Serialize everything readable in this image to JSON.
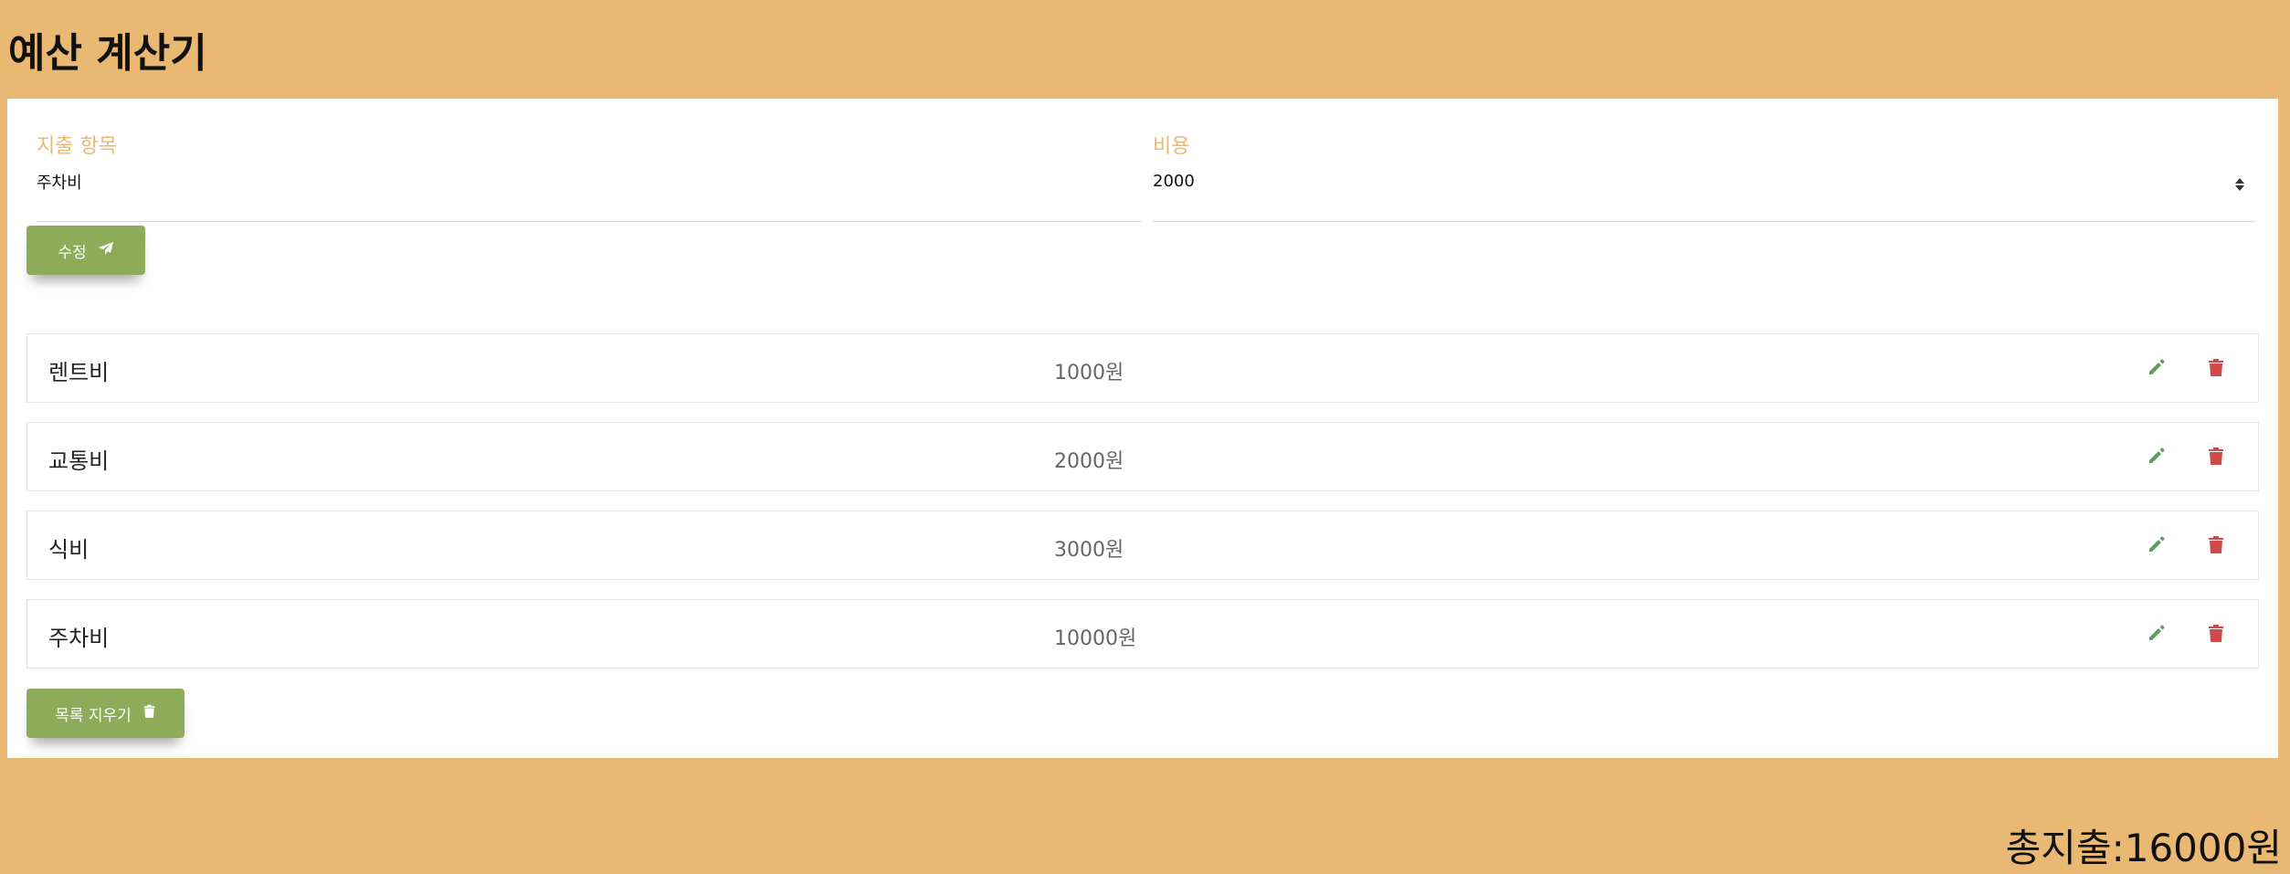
{
  "app": {
    "title": "예산 계산기"
  },
  "form": {
    "expense_label": "지출 항목",
    "expense_value": "주차비",
    "cost_label": "비용",
    "cost_value": "2000",
    "submit_label": "수정",
    "submit_icon": "paper-plane-icon"
  },
  "expenses": [
    {
      "name": "렌트비",
      "amount": "1000원"
    },
    {
      "name": "교통비",
      "amount": "2000원"
    },
    {
      "name": "식비",
      "amount": "3000원"
    },
    {
      "name": "주차비",
      "amount": "10000원"
    }
  ],
  "clear_button": {
    "label": "목록 지우기",
    "icon": "trash-icon"
  },
  "total": {
    "text": "총지출:16000원"
  },
  "colors": {
    "background": "#e9b872",
    "button": "#8dac5a",
    "edit_icon": "#5c9e5c",
    "delete_icon": "#cf4a4a",
    "label": "#e9b872"
  }
}
